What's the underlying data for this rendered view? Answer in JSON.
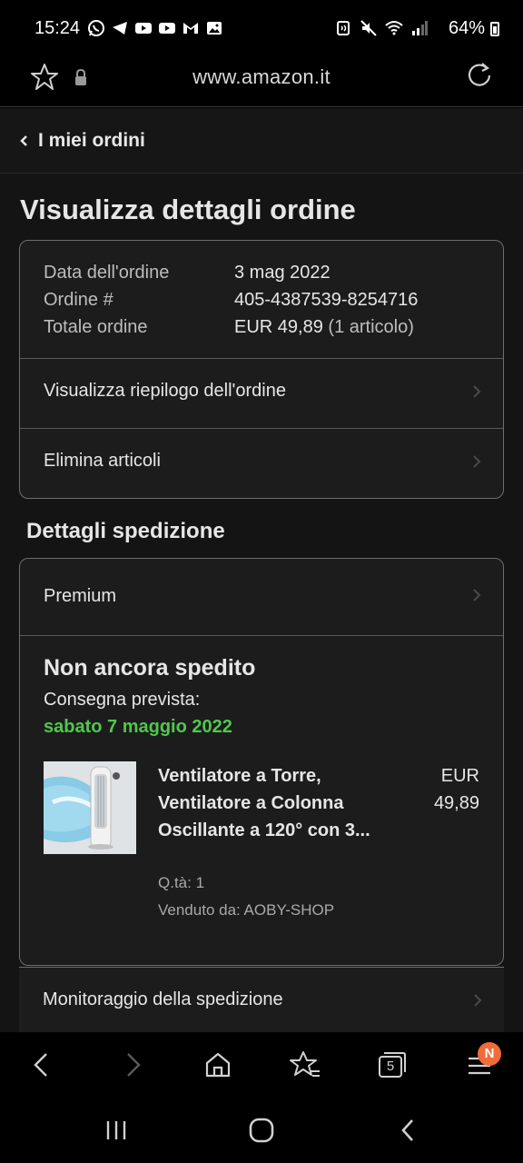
{
  "status_bar": {
    "time": "15:24",
    "battery": "64%",
    "left_icons": [
      "whatsapp-icon",
      "telegram-icon",
      "youtube-icon",
      "youtube-icon",
      "gmail-icon",
      "gallery-icon"
    ],
    "right_icons": [
      "nfc-icon",
      "mute-icon",
      "wifi-icon",
      "signal-icon",
      "battery-icon"
    ]
  },
  "url_bar": {
    "url": "www.amazon.it"
  },
  "nav": {
    "back_label": "I miei ordini"
  },
  "page": {
    "title": "Visualizza dettagli ordine"
  },
  "order_info": {
    "date_label": "Data dell'ordine",
    "date_value": "3 mag 2022",
    "number_label": "Ordine #",
    "number_value": "405-4387539-8254716",
    "total_label": "Totale ordine",
    "total_value": "EUR 49,89",
    "total_items": "(1 articolo)"
  },
  "order_actions": {
    "summary_label": "Visualizza riepilogo dell'ordine",
    "delete_label": "Elimina articoli"
  },
  "shipping": {
    "section_title": "Dettagli spedizione",
    "method": "Premium",
    "status_title": "Non ancora spedito",
    "delivery_label": "Consegna prevista:",
    "delivery_date": "sabato 7 maggio 2022",
    "delivery_color": "#51c74d",
    "tracking_label": "Monitoraggio della spedizione"
  },
  "product": {
    "name": "Ventilatore a Torre, Ventilatore a Colonna Oscillante a 120° con 3...",
    "qty": "Q.tà: 1",
    "seller": "Venduto da: AOBY-SHOP",
    "price_currency": "EUR",
    "price_value": "49,89"
  },
  "browser_bar": {
    "tabs_count": "5",
    "menu_badge": "N",
    "badge_color": "#f26b3a"
  }
}
